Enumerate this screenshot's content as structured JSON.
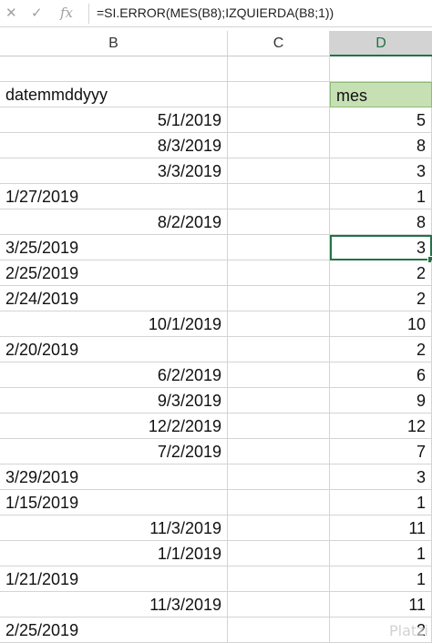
{
  "formula_bar": {
    "cancel_icon": "✕",
    "enter_icon": "✓",
    "fx_label": "fx",
    "formula": "=SI.ERROR(MES(B8);IZQUIERDA(B8;1))"
  },
  "columns": {
    "b": "B",
    "c": "C",
    "d": "D",
    "selected": "D"
  },
  "header_row": {
    "b": "datemmddyyy",
    "d": "mes"
  },
  "rows": [
    {
      "b": "5/1/2019",
      "b_align": "right",
      "d": "5"
    },
    {
      "b": "8/3/2019",
      "b_align": "right",
      "d": "8"
    },
    {
      "b": "3/3/2019",
      "b_align": "right",
      "d": "3"
    },
    {
      "b": "1/27/2019",
      "b_align": "left",
      "d": "1"
    },
    {
      "b": "8/2/2019",
      "b_align": "right",
      "d": "8"
    },
    {
      "b": "3/25/2019",
      "b_align": "left",
      "d": "3",
      "active": true
    },
    {
      "b": "2/25/2019",
      "b_align": "left",
      "d": "2"
    },
    {
      "b": "2/24/2019",
      "b_align": "left",
      "d": "2"
    },
    {
      "b": "10/1/2019",
      "b_align": "right",
      "d": "10"
    },
    {
      "b": "2/20/2019",
      "b_align": "left",
      "d": "2"
    },
    {
      "b": "6/2/2019",
      "b_align": "right",
      "d": "6"
    },
    {
      "b": "9/3/2019",
      "b_align": "right",
      "d": "9"
    },
    {
      "b": "12/2/2019",
      "b_align": "right",
      "d": "12"
    },
    {
      "b": "7/2/2019",
      "b_align": "right",
      "d": "7"
    },
    {
      "b": "3/29/2019",
      "b_align": "left",
      "d": "3"
    },
    {
      "b": "1/15/2019",
      "b_align": "left",
      "d": "1"
    },
    {
      "b": "11/3/2019",
      "b_align": "right",
      "d": "11"
    },
    {
      "b": "1/1/2019",
      "b_align": "right",
      "d": "1"
    },
    {
      "b": "1/21/2019",
      "b_align": "left",
      "d": "1"
    },
    {
      "b": "11/3/2019",
      "b_align": "right",
      "d": "11"
    },
    {
      "b": "2/25/2019",
      "b_align": "left",
      "d": "2"
    }
  ],
  "colors": {
    "header_fill": "#c6e0b4",
    "selection": "#217346"
  },
  "watermark": "Platzi"
}
